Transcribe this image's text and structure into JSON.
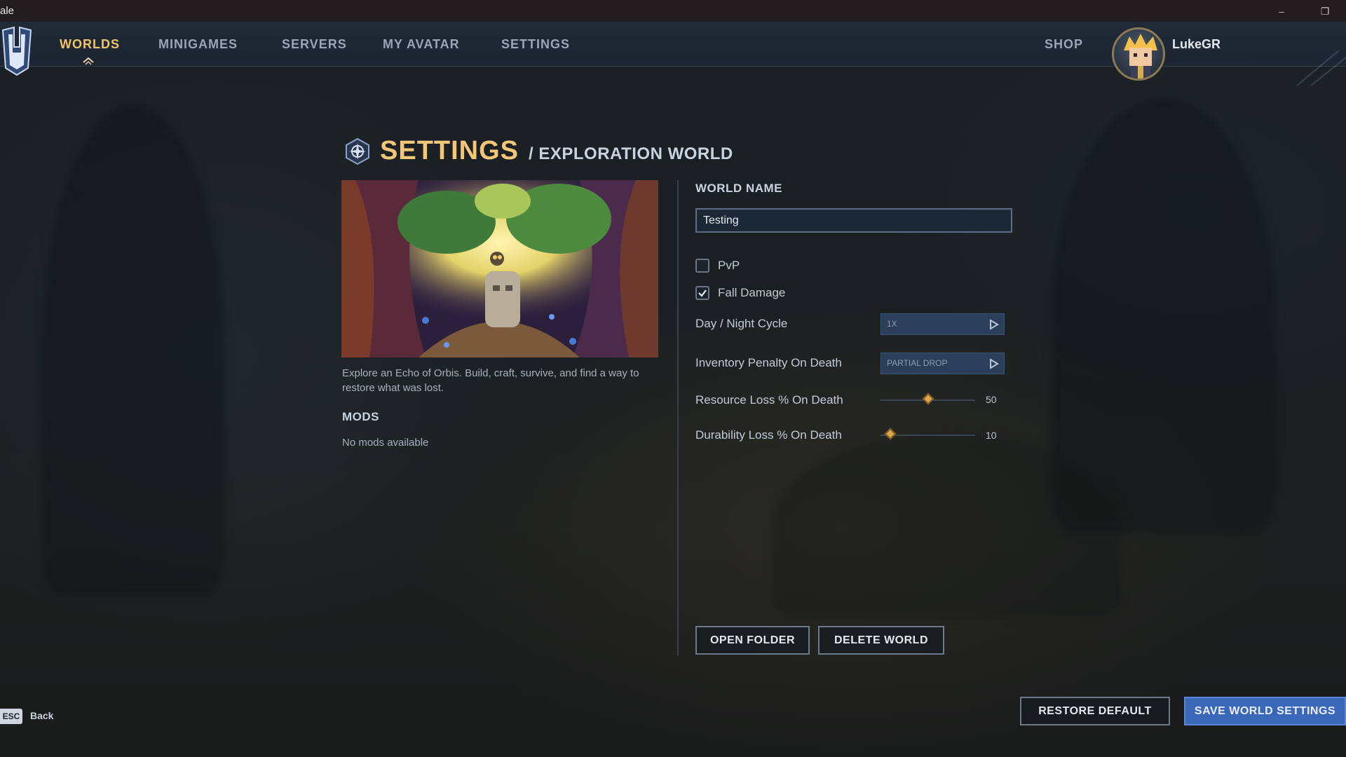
{
  "window": {
    "title": "ale",
    "minimize_icon": "minimize-icon",
    "restore_icon": "restore-icon"
  },
  "nav": {
    "items": [
      {
        "label": "WORLDS",
        "active": true
      },
      {
        "label": "MINIGAMES",
        "active": false
      },
      {
        "label": "SERVERS",
        "active": false
      },
      {
        "label": "MY AVATAR",
        "active": false
      },
      {
        "label": "SETTINGS",
        "active": false
      }
    ],
    "shop": "SHOP",
    "username": "LukeGR",
    "accent_color": "#f0c46a"
  },
  "header": {
    "title": "SETTINGS",
    "subtitle": "/ EXPLORATION WORLD"
  },
  "world": {
    "description": "Explore an Echo of Orbis. Build, craft, survive, and find a way to restore what was lost.",
    "mods_title": "MODS",
    "mods_empty": "No mods available"
  },
  "form": {
    "world_name_label": "WORLD NAME",
    "world_name_value": "Testing",
    "pvp": {
      "label": "PvP",
      "checked": false
    },
    "fall_damage": {
      "label": "Fall Damage",
      "checked": true
    },
    "day_night": {
      "label": "Day / Night Cycle",
      "value": "1X"
    },
    "inventory_penalty": {
      "label": "Inventory Penalty On Death",
      "value": "PARTIAL DROP"
    },
    "resource_loss": {
      "label": "Resource Loss % On Death",
      "value": "50",
      "level": 0.5
    },
    "durability_loss": {
      "label": "Durability Loss % On Death",
      "value": "10",
      "level": 0.1
    }
  },
  "actions": {
    "open_folder": "OPEN FOLDER",
    "delete_world": "DELETE WORLD",
    "restore_default": "RESTORE DEFAULT",
    "save": "SAVE WORLD SETTINGS"
  },
  "footer": {
    "esc_key": "ESC",
    "back": "Back"
  }
}
